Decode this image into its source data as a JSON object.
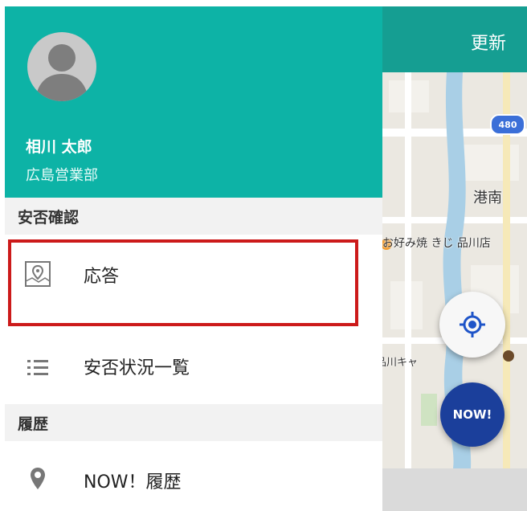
{
  "header": {
    "refresh_label": "更新"
  },
  "user": {
    "name": "相川 太郎",
    "department": "広島営業部"
  },
  "sections": {
    "safety": {
      "title": "安否確認"
    },
    "history": {
      "title": "履歴"
    }
  },
  "menu": {
    "respond": {
      "label": "応答",
      "icon": "map-pin-box-icon"
    },
    "status_list": {
      "label": "安否状況一覧",
      "icon": "list-icon"
    },
    "now_history": {
      "label": "NOW！履歴",
      "icon": "location-pin-icon"
    }
  },
  "map": {
    "labels": {
      "minato": "港南",
      "okonomi": "お好み焼 きじ 品川店",
      "shinagawa": "品川キャ"
    },
    "route_badge": "480",
    "now_button": "NOW!"
  },
  "colors": {
    "drawer_header": "#0db3a6",
    "map_header": "#159e92",
    "highlight": "#cc1a1a",
    "now_button": "#1b3f9b"
  }
}
